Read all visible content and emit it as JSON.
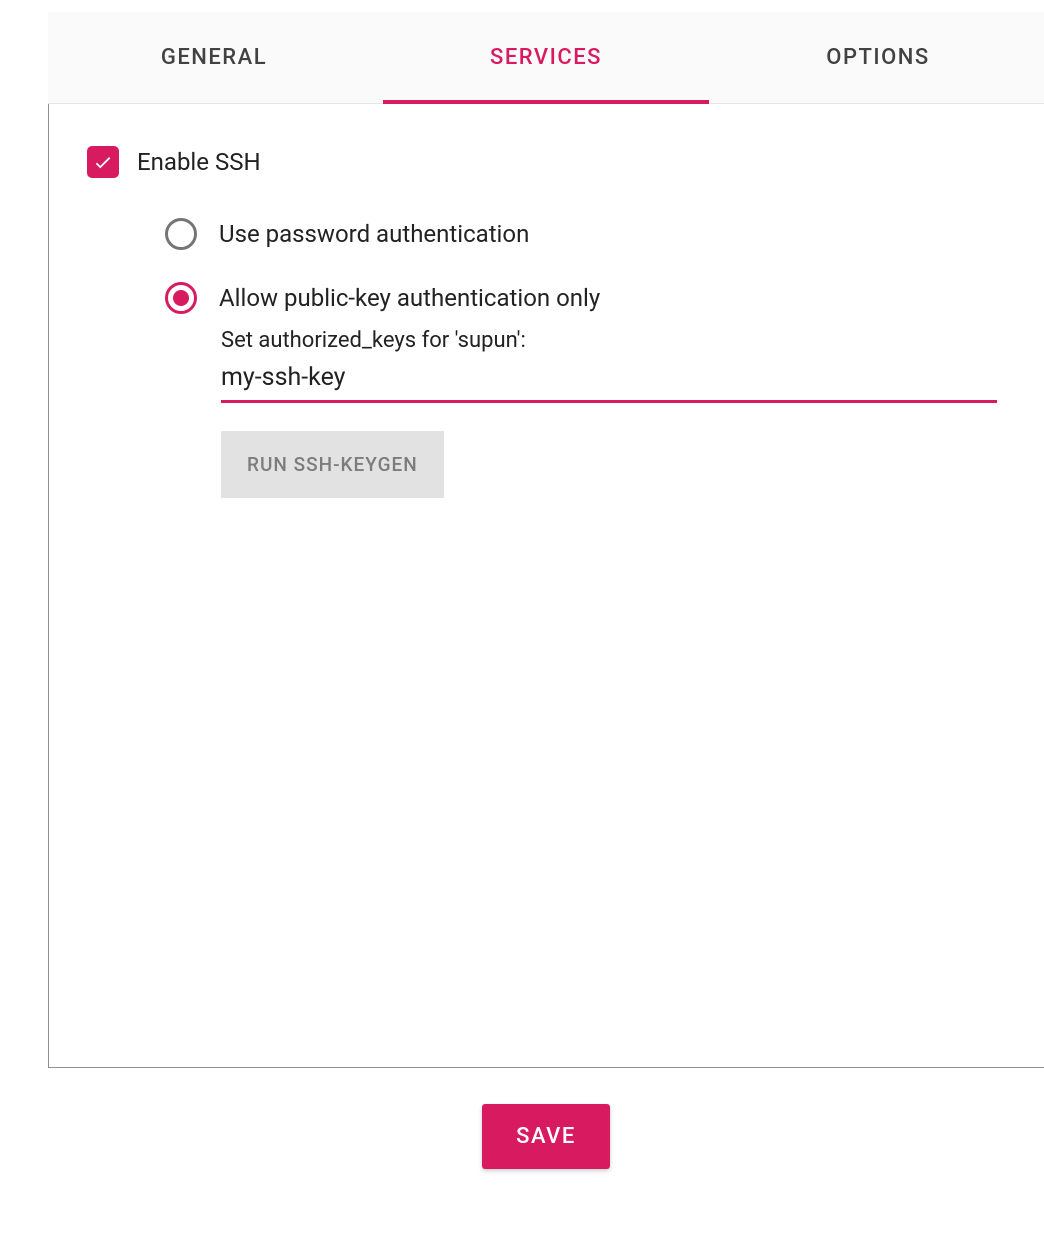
{
  "tabs": {
    "general": "GENERAL",
    "services": "SERVICES",
    "options": "OPTIONS"
  },
  "ssh": {
    "enable_label": "Enable SSH",
    "auth": {
      "password_label": "Use password authentication",
      "publickey_label": "Allow public-key authentication only"
    },
    "authorized_keys_label": "Set authorized_keys for 'supun':",
    "key_value": "my-ssh-key",
    "keygen_button": "RUN SSH-KEYGEN"
  },
  "footer": {
    "save_label": "SAVE"
  },
  "colors": {
    "accent": "#d81b60"
  }
}
